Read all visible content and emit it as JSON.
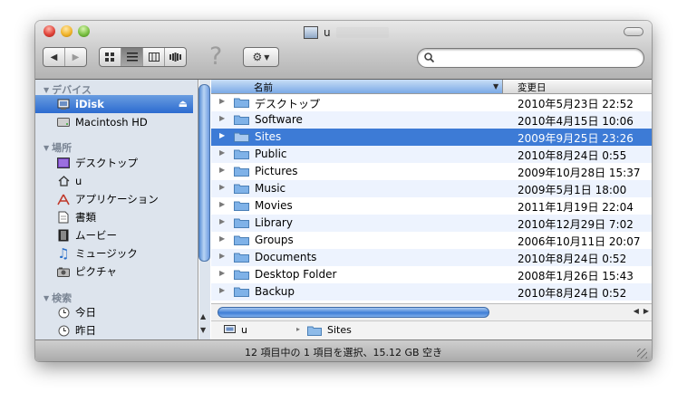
{
  "window": {
    "title": "u"
  },
  "toolbar": {
    "help_glyph": "?"
  },
  "sidebar": {
    "sections": [
      {
        "header": "デバイス",
        "items": [
          {
            "label": "iDisk",
            "icon": "idisk-icon",
            "selected": true
          },
          {
            "label": "Macintosh HD",
            "icon": "hard-drive-icon",
            "selected": false
          }
        ]
      },
      {
        "header": "場所",
        "items": [
          {
            "label": "デスクトップ",
            "icon": "desktop-icon"
          },
          {
            "label": "u",
            "icon": "home-icon"
          },
          {
            "label": "アプリケーション",
            "icon": "applications-icon"
          },
          {
            "label": "書類",
            "icon": "documents-icon"
          },
          {
            "label": "ムービー",
            "icon": "movies-icon"
          },
          {
            "label": "ミュージック",
            "icon": "music-icon"
          },
          {
            "label": "ピクチャ",
            "icon": "pictures-icon"
          }
        ]
      },
      {
        "header": "検索",
        "items": [
          {
            "label": "今日",
            "icon": "clock-icon"
          },
          {
            "label": "昨日",
            "icon": "clock-icon"
          }
        ]
      }
    ]
  },
  "list": {
    "headers": {
      "name": "名前",
      "modified": "変更日"
    },
    "rows": [
      {
        "name": "デスクトップ",
        "modified": "2010年5月23日 22:52"
      },
      {
        "name": "Software",
        "modified": "2010年4月15日 10:06"
      },
      {
        "name": "Sites",
        "modified": "2009年9月25日 23:26",
        "selected": true
      },
      {
        "name": "Public",
        "modified": "2010年8月24日 0:55"
      },
      {
        "name": "Pictures",
        "modified": "2009年10月28日 15:37"
      },
      {
        "name": "Music",
        "modified": "2009年5月1日 18:00"
      },
      {
        "name": "Movies",
        "modified": "2011年1月19日 22:04"
      },
      {
        "name": "Library",
        "modified": "2010年12月29日 7:02"
      },
      {
        "name": "Groups",
        "modified": "2006年10月11日 20:07"
      },
      {
        "name": "Documents",
        "modified": "2010年8月24日 0:52"
      },
      {
        "name": "Desktop Folder",
        "modified": "2008年1月26日 15:43"
      },
      {
        "name": "Backup",
        "modified": "2010年8月24日 0:52"
      }
    ]
  },
  "pathbar": {
    "root": "u",
    "current": "Sites"
  },
  "status": {
    "text": "12 項目中の 1 項目を選択、15.12 GB 空き"
  },
  "colors": {
    "selection": "#3d7bd6",
    "sidebar_bg": "#dde4ed",
    "alt_row": "#edf3fe",
    "folder": "#7fb2e8"
  }
}
